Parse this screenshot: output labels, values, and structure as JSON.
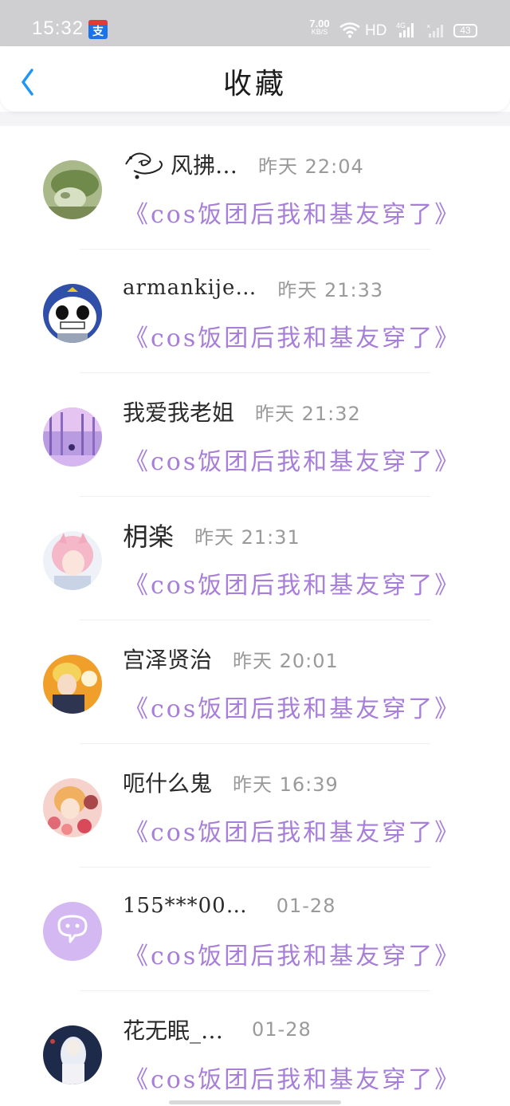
{
  "status_bar": {
    "time": "15:32",
    "notification_icon_text": "支",
    "net_speed_value": "7.00",
    "net_speed_unit": "KB/S",
    "hd_label": "HD",
    "battery": "43"
  },
  "header": {
    "title": "收藏",
    "accent_color": "#2196f3"
  },
  "items": [
    {
      "name": "风拂…",
      "time": "昨天 22:04",
      "post": "《cos饭团后我和基友穿了》",
      "avatar": "green-creature"
    },
    {
      "name": "armankije…",
      "time": "昨天 21:33",
      "post": "《cos饭团后我和基友穿了》",
      "avatar": "panda-cartoon"
    },
    {
      "name": "我爱我老姐",
      "time": "昨天 21:32",
      "post": "《cos饭团后我和基友穿了》",
      "avatar": "purple-forest"
    },
    {
      "name": "枂楽",
      "time": "昨天 21:31",
      "post": "《cos饭团后我和基友穿了》",
      "avatar": "pink-hair-girl"
    },
    {
      "name": "宫泽贤治",
      "time": "昨天 20:01",
      "post": "《cos饭团后我和基友穿了》",
      "avatar": "blonde-character"
    },
    {
      "name": "呃什么鬼",
      "time": "昨天 16:39",
      "post": "《cos饭团后我和基友穿了》",
      "avatar": "flower-boy"
    },
    {
      "name": "155***00…",
      "time": "01-28",
      "post": "《cos饭团后我和基友穿了》",
      "avatar": "default-chat-avatar"
    },
    {
      "name": "花无眠_…",
      "time": "01-28",
      "post": "《cos饭团后我和基友穿了》",
      "avatar": "white-hair-character"
    }
  ],
  "colors": {
    "post_title": "#a77ed8",
    "time": "#9a9a9a",
    "default_avatar_bg": "#d3b8f2"
  }
}
